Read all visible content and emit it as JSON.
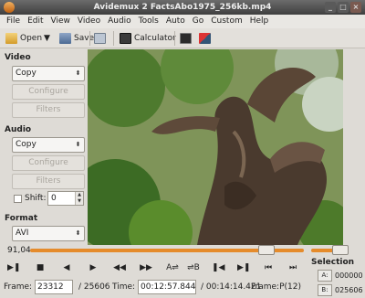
{
  "window": {
    "title": "Avidemux 2 FactsAbo1975_256kb.mp4",
    "minimize": "_",
    "maximize": "□",
    "close": "×"
  },
  "menu": [
    "File",
    "Edit",
    "View",
    "Video",
    "Audio",
    "Tools",
    "Auto",
    "Go",
    "Custom",
    "Help"
  ],
  "toolbar": {
    "open_label": "Open",
    "save_label": "Save",
    "calculator_label": "Calculator"
  },
  "video_section": {
    "heading": "Video",
    "codec": "Copy",
    "configure": "Configure",
    "filters": "Filters"
  },
  "audio_section": {
    "heading": "Audio",
    "codec": "Copy",
    "configure": "Configure",
    "filters": "Filters",
    "shift_label": "Shift:",
    "shift_value": "0"
  },
  "format_section": {
    "heading": "Format",
    "container": "AVI"
  },
  "timeline": {
    "value_label": "91,04",
    "position": 0.887
  },
  "status": {
    "frame_label": "Frame:",
    "frame_value": "23312",
    "frame_total": "/ 25606",
    "time_label": "Time:",
    "time_value": "00:12:57.844",
    "time_total": "/ 00:14:14.421",
    "frame_type": "Frame:P(12)"
  },
  "selection": {
    "title": "Selection",
    "a_label": "A:",
    "a_value": "000000",
    "b_label": "B:",
    "b_value": "025606"
  },
  "colors": {
    "accent": "#e58b2b",
    "window_bg": "#dedbd6",
    "titlebar": "#4a4a4a"
  }
}
